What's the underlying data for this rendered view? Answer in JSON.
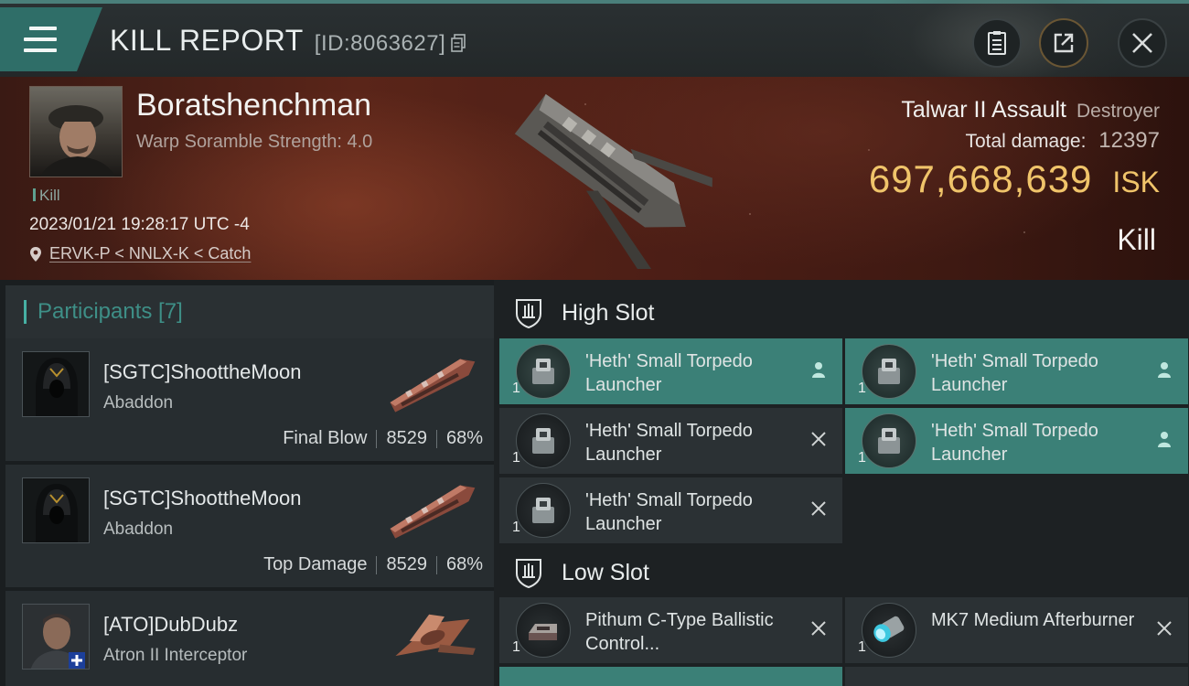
{
  "header": {
    "title": "KILL REPORT",
    "report_id": "[ID:8063627]",
    "icons": [
      "menu-icon",
      "copy-icon",
      "report-icon",
      "share-icon",
      "close-icon"
    ]
  },
  "victim": {
    "name": "Boratshenchman",
    "scramble": "Warp Soramble Strength: 4.0",
    "tag": "Kill",
    "timestamp": "2023/01/21 19:28:17 UTC -4",
    "location": "ERVK-P < NNLX-K < Catch",
    "ship_name": "Talwar II Assault",
    "ship_class": "Destroyer",
    "total_damage_label": "Total damage:",
    "total_damage": "12397",
    "isk_value": "697,668,639",
    "isk_unit": "ISK",
    "result": "Kill"
  },
  "participants": {
    "header": "Participants [7]",
    "items": [
      {
        "name": "[SGTC]ShoottheMoon",
        "ship": "Abaddon",
        "label": "Final Blow",
        "damage": "8529",
        "percent": "68%"
      },
      {
        "name": "[SGTC]ShoottheMoon",
        "ship": "Abaddon",
        "label": "Top Damage",
        "damage": "8529",
        "percent": "68%"
      },
      {
        "name": "[ATO]DubDubz",
        "ship": "Atron II Interceptor",
        "label": "",
        "damage": "",
        "percent": ""
      }
    ]
  },
  "slots": {
    "high": {
      "title": "High Slot",
      "modules": [
        {
          "name": "'Heth' Small Torpedo Launcher",
          "qty": "1",
          "state": "dropped"
        },
        {
          "name": "'Heth' Small Torpedo Launcher",
          "qty": "1",
          "state": "dropped"
        },
        {
          "name": "'Heth' Small Torpedo Launcher",
          "qty": "1",
          "state": "destroyed"
        },
        {
          "name": "'Heth' Small Torpedo Launcher",
          "qty": "1",
          "state": "dropped"
        },
        {
          "name": "'Heth' Small Torpedo Launcher",
          "qty": "1",
          "state": "destroyed"
        }
      ]
    },
    "low": {
      "title": "Low Slot",
      "modules": [
        {
          "name": "Pithum C-Type Ballistic Control...",
          "qty": "1",
          "state": "destroyed"
        },
        {
          "name": "MK7 Medium Afterburner",
          "qty": "1",
          "state": "destroyed"
        }
      ]
    }
  },
  "colors": {
    "accent": "#3b8077",
    "isk": "#f0c46a",
    "panel": "#2b3134"
  }
}
